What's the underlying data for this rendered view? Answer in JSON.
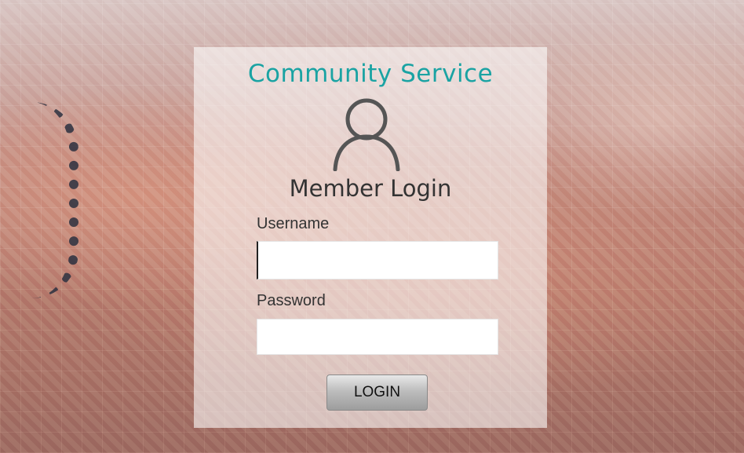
{
  "app": {
    "title": "Community Service",
    "subtitle": "Member Login"
  },
  "form": {
    "username_label": "Username",
    "username_value": "",
    "password_label": "Password",
    "password_value": "",
    "login_label": "LOGIN"
  },
  "icons": {
    "user": "user-icon"
  },
  "colors": {
    "title": "#1aa3a3",
    "panel": "rgba(255,255,255,0.58)",
    "button": "#bdbdbd"
  }
}
